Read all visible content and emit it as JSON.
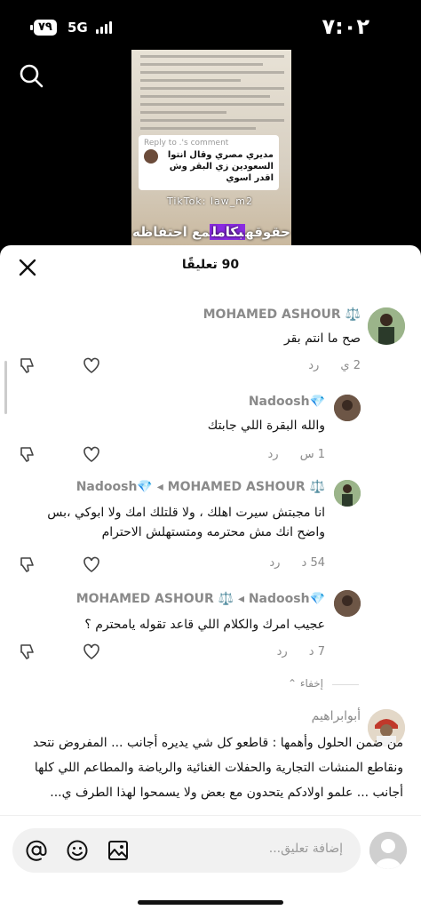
{
  "status_bar": {
    "time": "٧:٠٢",
    "network": "5G",
    "battery": "٧٩"
  },
  "video": {
    "reply_title": "Reply to .'s comment",
    "reply_text": "مديري مصري وقال انتوا السعودين زي البقر وش اقدر اسوي",
    "watermark": "TikTok: law_m2",
    "caption_pre": "مع احتفاظه ",
    "caption_highlight": "بكامل",
    "caption_post": " حقوقه"
  },
  "sheet": {
    "title": "90 تعليقًا"
  },
  "comments": [
    {
      "name": "MOHAMED ASHOUR ⚖️",
      "text": "صح ما انتم بقر",
      "time": "2 ي",
      "reply": "رد"
    },
    {
      "name": "Nadoosh💎",
      "text": "والله البقرة اللي جابتك",
      "time": "1 س",
      "reply": "رد"
    },
    {
      "name": "Nadoosh💎 ◂ MOHAMED ASHOUR ⚖️",
      "text": "انا مجبتش سيرت اهلك ، ولا قلتلك امك ولا ابوكي ،بس واضح انك مش محترمه ومتستهلش الاحترام",
      "time": "54 د",
      "reply": "رد"
    },
    {
      "name": "MOHAMED ASHOUR ⚖️ ◂ Nadoosh💎",
      "text": "عجيب امرك والكلام اللي قاعد تقوله يامحترم ؟",
      "time": "7 د",
      "reply": "رد"
    },
    {
      "name": "أبوابراهيم",
      "text": "من ضمن الحلول وأهمها : قاطعو كل شي يديره أجانب ... المفروض نتحد ونقاطع المنشات التجارية والحفلات الغنائية والرياضة والمطاعم اللي كلها أجانب ... علمو اولادكم يتحدون مع بعض ولا يسمحوا لهذا الطرف ي..."
    }
  ],
  "collapse_label": "إخفاء",
  "input": {
    "placeholder": "إضافة تعليق..."
  },
  "colors": {
    "caption_highlight": "#8a2be2",
    "secondary_text": "#8a8a8a"
  }
}
